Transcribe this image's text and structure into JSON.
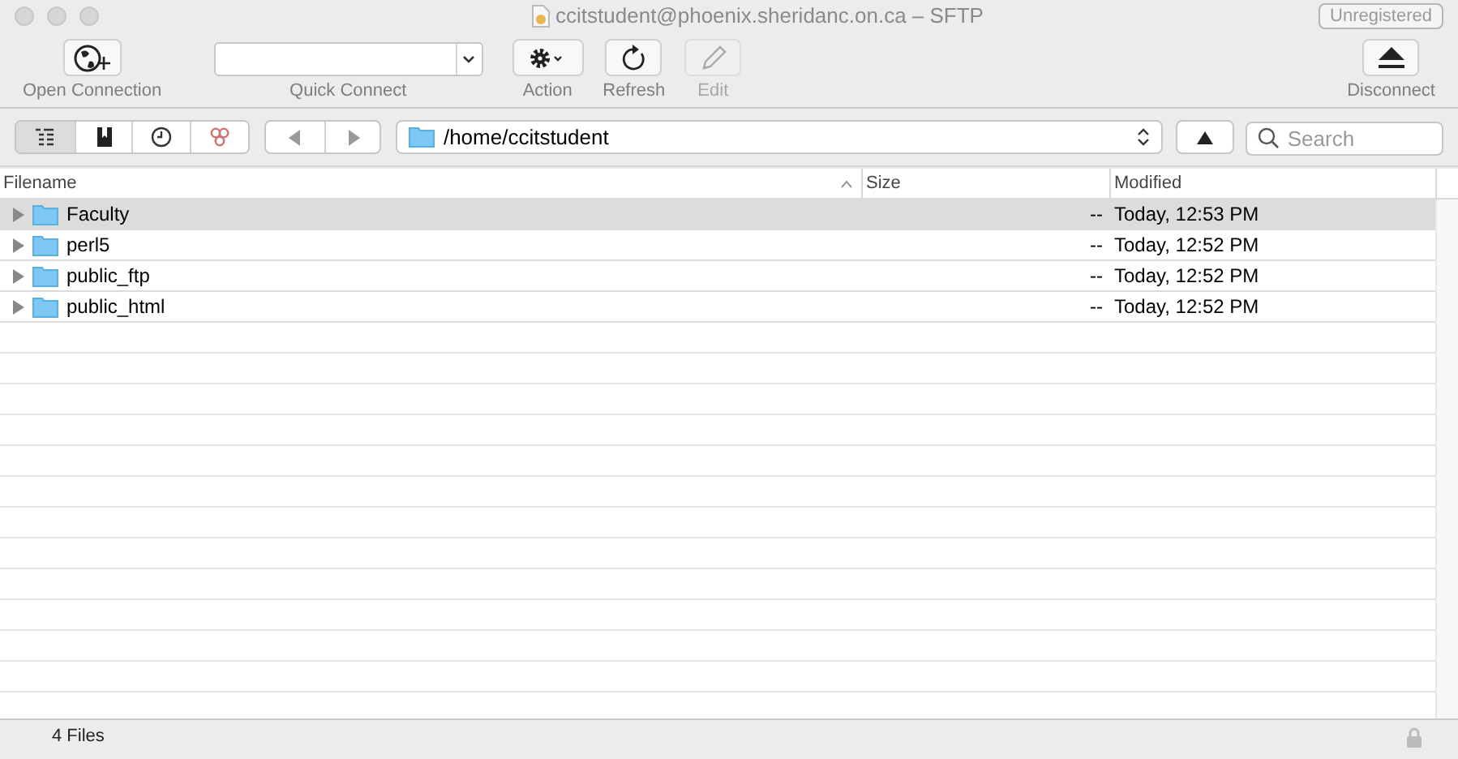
{
  "window": {
    "title": "ccitstudent@phoenix.sheridanc.on.ca – SFTP",
    "badge": "Unregistered"
  },
  "toolbar": [
    {
      "kind": "open",
      "label": "Open Connection",
      "disabled": false
    },
    {
      "kind": "field",
      "label": "Quick Connect",
      "disabled": false
    },
    {
      "kind": "action",
      "label": "Action",
      "disabled": false
    },
    {
      "kind": "refresh",
      "label": "Refresh",
      "disabled": false
    },
    {
      "kind": "edit",
      "label": "Edit",
      "disabled": true
    },
    {
      "kind": "disconnect",
      "label": "Disconnect",
      "disabled": false
    }
  ],
  "view_tabs": [
    {
      "kind": "browser",
      "selected": true
    },
    {
      "kind": "bookmarks",
      "selected": false
    },
    {
      "kind": "history",
      "selected": false
    },
    {
      "kind": "bonjour",
      "selected": false
    }
  ],
  "path": "/home/ccitstudent",
  "search": {
    "placeholder": "Search"
  },
  "table": {
    "columns": [
      "Filename",
      "Size",
      "Modified"
    ],
    "rows": [
      {
        "name": "Faculty",
        "size": "--",
        "modified": "Today, 12:53 PM",
        "selected": true
      },
      {
        "name": "perl5",
        "size": "--",
        "modified": "Today, 12:52 PM",
        "selected": false
      },
      {
        "name": "public_ftp",
        "size": "--",
        "modified": "Today, 12:52 PM",
        "selected": false
      },
      {
        "name": "public_html",
        "size": "--",
        "modified": "Today, 12:52 PM",
        "selected": false
      }
    ]
  },
  "status_bar": {
    "text": "4 Files"
  }
}
